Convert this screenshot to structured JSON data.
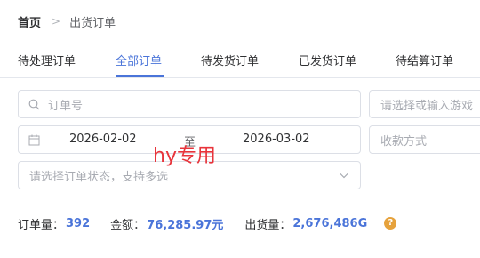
{
  "breadcrumb": {
    "home": "首页",
    "separator": ">",
    "current": "出货订单"
  },
  "tabs": [
    {
      "label": "待处理订单"
    },
    {
      "label": "全部订单",
      "active": true
    },
    {
      "label": "待发货订单"
    },
    {
      "label": "已发货订单"
    },
    {
      "label": "待结算订单"
    }
  ],
  "filters": {
    "order_no_placeholder": "订单号",
    "game_placeholder": "请选择或输入游戏",
    "date_start": "2026-02-02",
    "date_to": "至",
    "date_end": "2026-03-02",
    "payment_placeholder": "收款方式",
    "status_placeholder": "请选择订单状态，支持多选"
  },
  "watermark": "hy专用",
  "stats": {
    "order_count_label": "订单量：",
    "order_count": "392",
    "amount_label": "金额：",
    "amount": "76,285.97元",
    "shipped_label": "出货量：",
    "shipped": "2,676,486G",
    "help_glyph": "?"
  },
  "colors": {
    "accent": "#4a74d9",
    "watermark": "#e8343b",
    "help": "#e6a23c"
  }
}
